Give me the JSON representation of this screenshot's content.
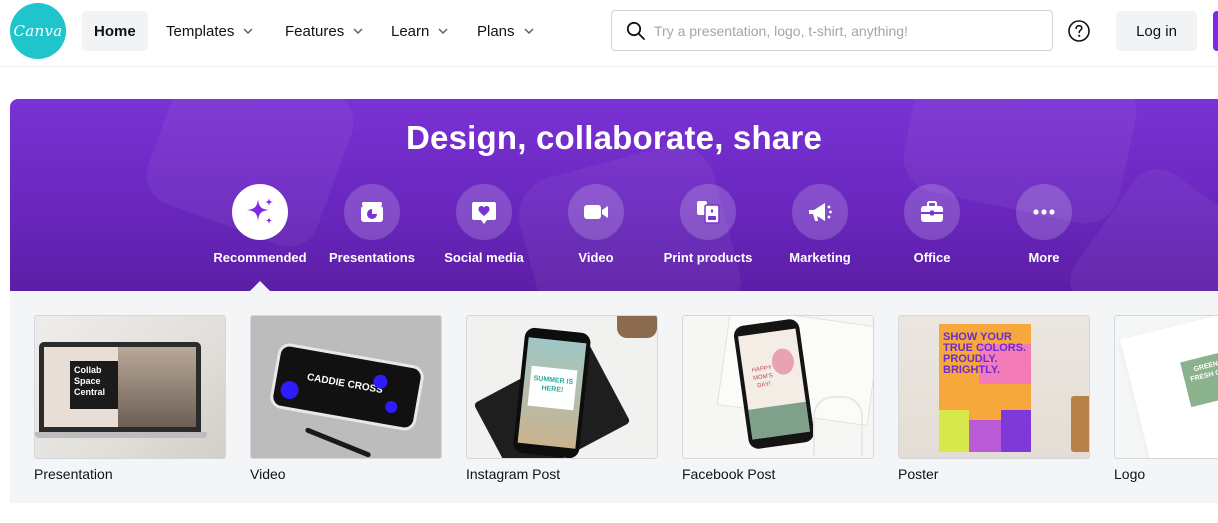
{
  "brand": {
    "logo_text": "Canva",
    "accent": "#7d2ae8",
    "logo_color": "#20c4cb"
  },
  "nav": {
    "home": "Home",
    "templates": "Templates",
    "features": "Features",
    "learn": "Learn",
    "plans": "Plans"
  },
  "search": {
    "placeholder": "Try a presentation, logo, t-shirt, anything!",
    "value": ""
  },
  "login_label": "Log in",
  "hero": {
    "title": "Design, collaborate, share",
    "categories": [
      {
        "label": "Recommended",
        "icon": "sparkle-icon",
        "active": true
      },
      {
        "label": "Presentations",
        "icon": "presentation-chart-icon"
      },
      {
        "label": "Social media",
        "icon": "heart-bubble-icon"
      },
      {
        "label": "Video",
        "icon": "video-camera-icon"
      },
      {
        "label": "Print products",
        "icon": "print-products-icon"
      },
      {
        "label": "Marketing",
        "icon": "megaphone-icon"
      },
      {
        "label": "Office",
        "icon": "briefcase-icon"
      },
      {
        "label": "More",
        "icon": "more-dots-icon"
      }
    ]
  },
  "cards": [
    {
      "label": "Presentation",
      "thumb_text": "Collab Space Central"
    },
    {
      "label": "Video",
      "thumb_text": "CADDIE CROSS"
    },
    {
      "label": "Instagram Post",
      "thumb_text": "SUMMER IS HERE!"
    },
    {
      "label": "Facebook Post",
      "thumb_text": "HAPPY MOM'S DAY!"
    },
    {
      "label": "Poster",
      "thumb_text": "SHOW YOUR TRUE COLORS. PROUDLY. BRIGHTLY."
    },
    {
      "label": "Logo",
      "thumb_text": "GREEN FRESH CO"
    }
  ]
}
